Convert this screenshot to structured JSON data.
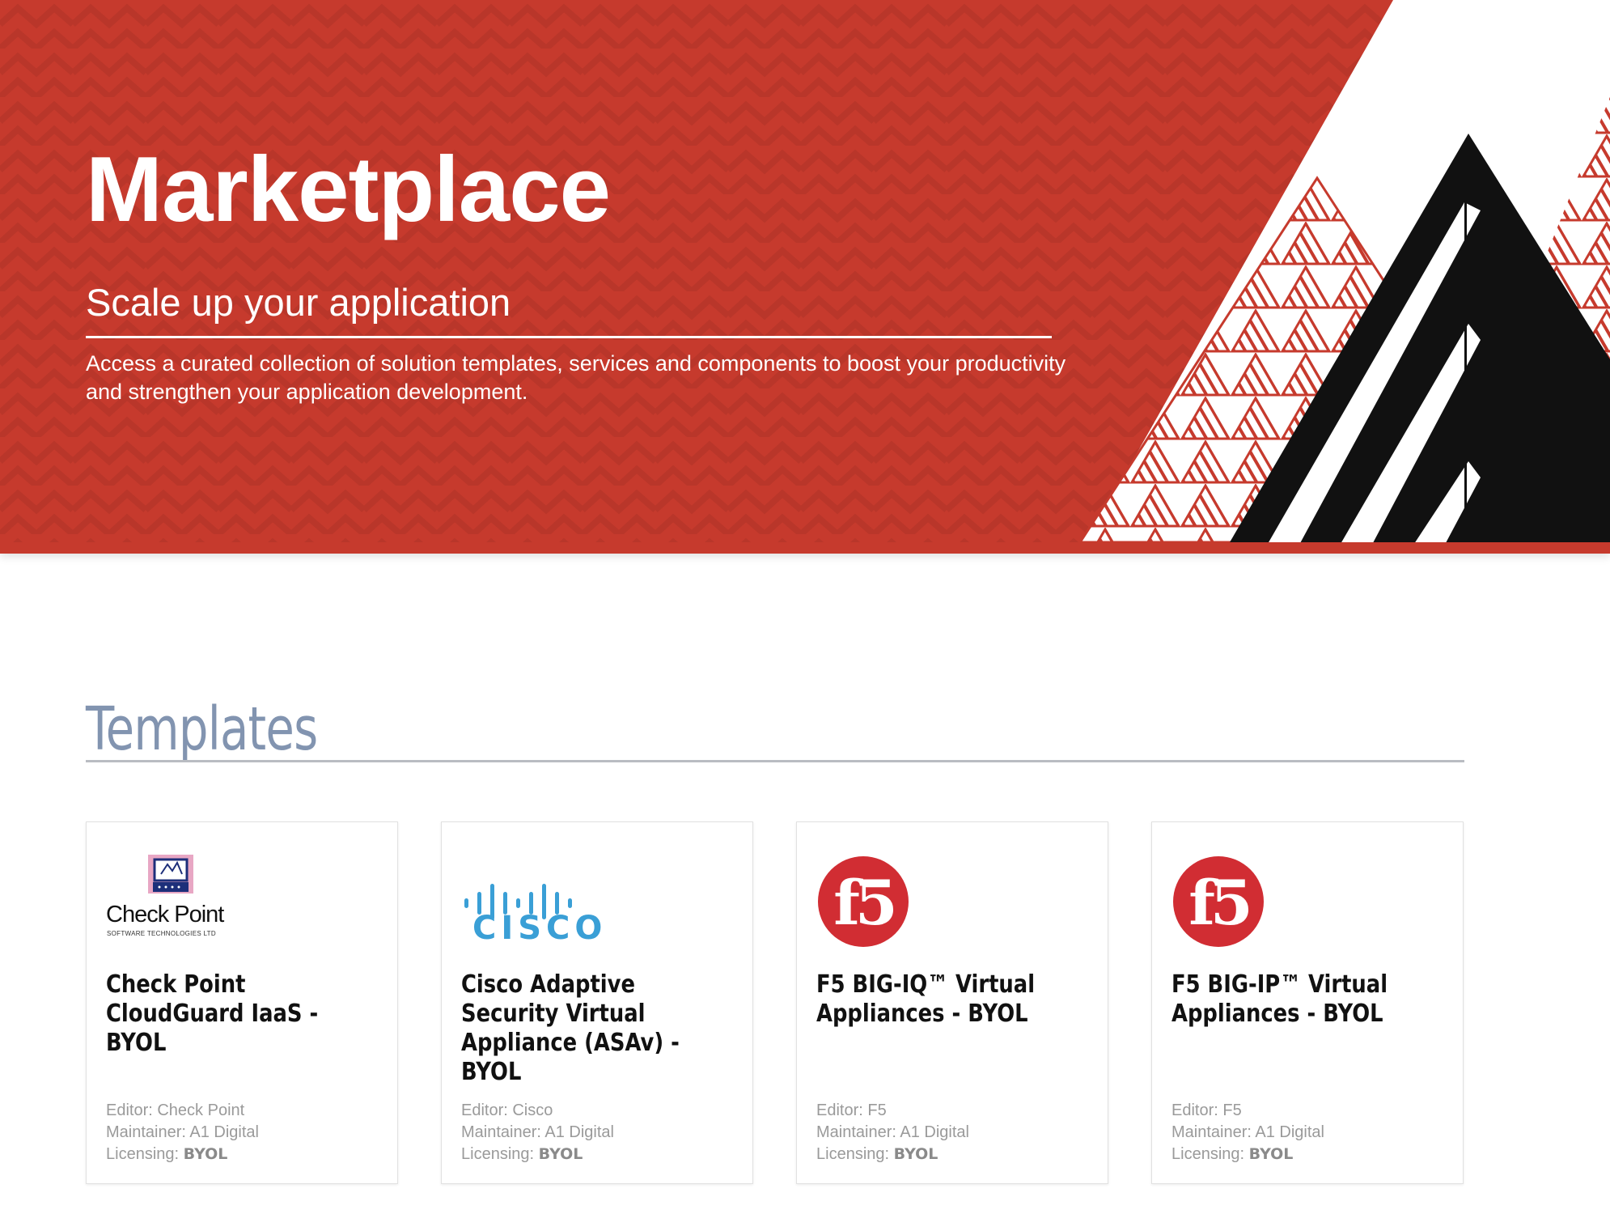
{
  "hero": {
    "title": "Marketplace",
    "subtitle": "Scale up your application",
    "description": "Access a curated collection of solution templates, services and components to boost your productivity and strengthen your application development."
  },
  "section": {
    "title": "Templates"
  },
  "colors": {
    "hero_red": "#c63a2d",
    "section_title": "#8294b0",
    "cisco_blue": "#3a9fd6",
    "f5_red": "#d12d33"
  },
  "cards": [
    {
      "logo": "checkpoint-logo",
      "logo_text": "Check Point",
      "logo_subtext": "SOFTWARE TECHNOLOGIES LTD",
      "title": "Check Point CloudGuard IaaS - BYOL",
      "editor": "Editor: Check Point",
      "maintainer": "Maintainer: A1 Digital",
      "licensing_label": "Licensing: ",
      "licensing_value": "BYOL"
    },
    {
      "logo": "cisco-logo",
      "logo_text": "CISCO",
      "title": "Cisco Adaptive Security Virtual Appliance (ASAv) - BYOL",
      "editor": "Editor: Cisco",
      "maintainer": "Maintainer: A1 Digital",
      "licensing_label": "Licensing: ",
      "licensing_value": "BYOL"
    },
    {
      "logo": "f5-logo",
      "logo_text": "f5",
      "title": "F5 BIG-IQ™ Virtual Appliances - BYOL",
      "editor": "Editor: F5",
      "maintainer": "Maintainer: A1 Digital",
      "licensing_label": "Licensing: ",
      "licensing_value": "BYOL"
    },
    {
      "logo": "f5-logo",
      "logo_text": "f5",
      "title": "F5 BIG-IP™ Virtual Appliances - BYOL",
      "editor": "Editor: F5",
      "maintainer": "Maintainer: A1 Digital",
      "licensing_label": "Licensing: ",
      "licensing_value": "BYOL"
    }
  ]
}
